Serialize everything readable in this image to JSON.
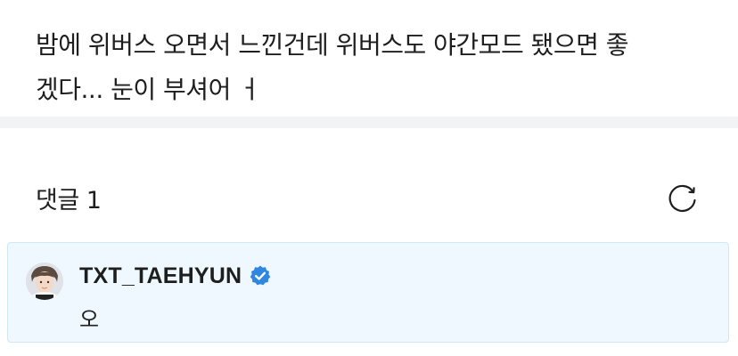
{
  "post": {
    "lines": [
      "밤에 위버스 오면서 느낀건데 위버스도 야간모드 됐으면 좋",
      "겠다... 눈이 부셔어 ㅓ"
    ]
  },
  "comments": {
    "title": "댓글",
    "count": "1",
    "refresh_icon": "refresh-icon",
    "items": [
      {
        "author": "TXT_TAEHYUN",
        "verified": true,
        "verified_color": "#2f87e0",
        "text": "오"
      }
    ]
  },
  "colors": {
    "divider": "#f2f3f5",
    "comment_highlight_bg": "#eef8fe",
    "comment_highlight_border": "#cfe8f7"
  }
}
